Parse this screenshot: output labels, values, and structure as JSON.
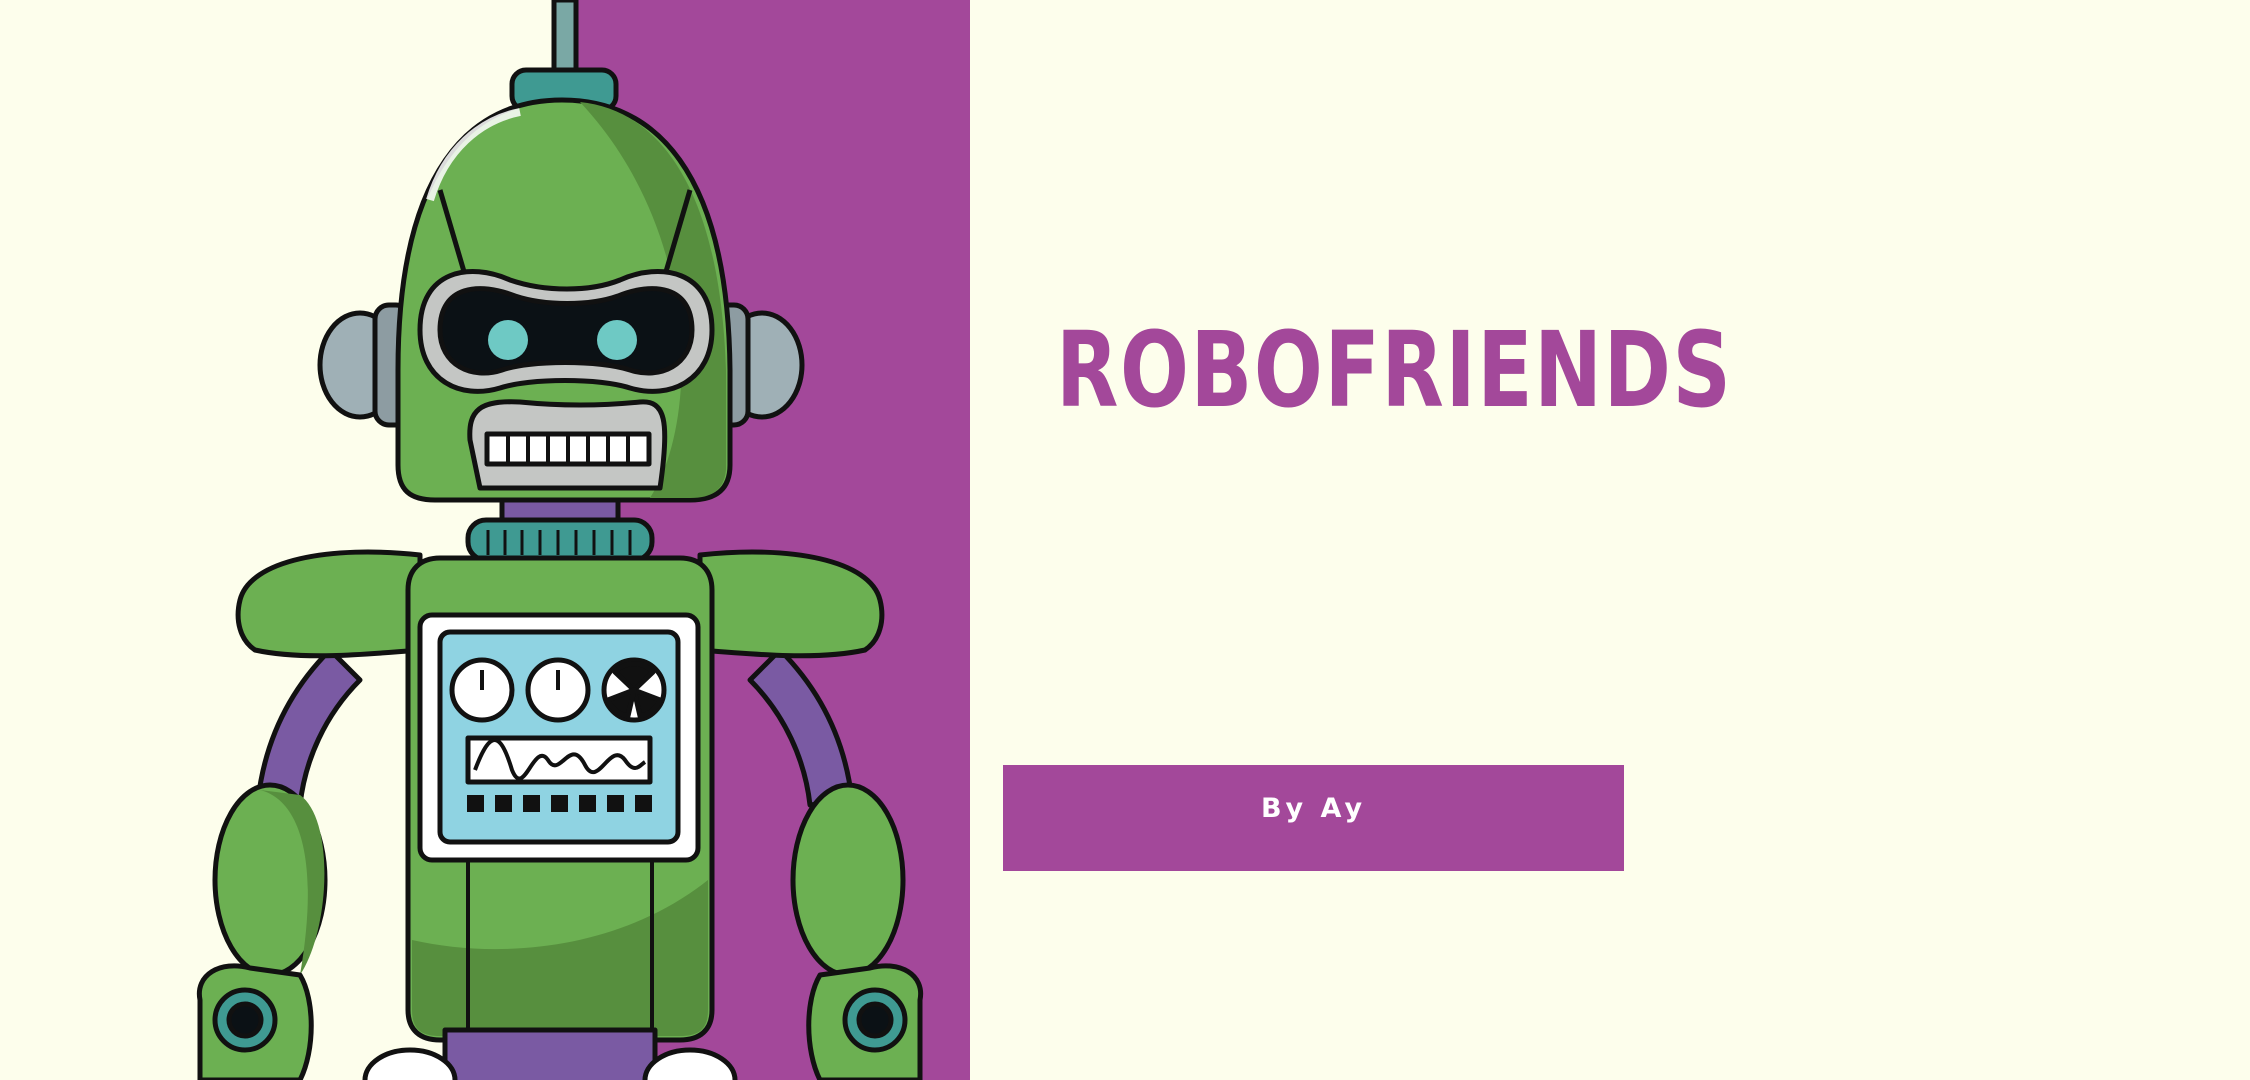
{
  "hero": {
    "title": "ROBOFRIENDS",
    "byline": "By Ay",
    "illustration": "robot-illustration"
  },
  "colors": {
    "background": "#fdfeec",
    "accent_purple": "#a3489a",
    "robot_green": "#6cb052",
    "robot_dark_green": "#578f3e",
    "robot_teal": "#3f9a92",
    "screen_blue": "#8fd3e2"
  }
}
